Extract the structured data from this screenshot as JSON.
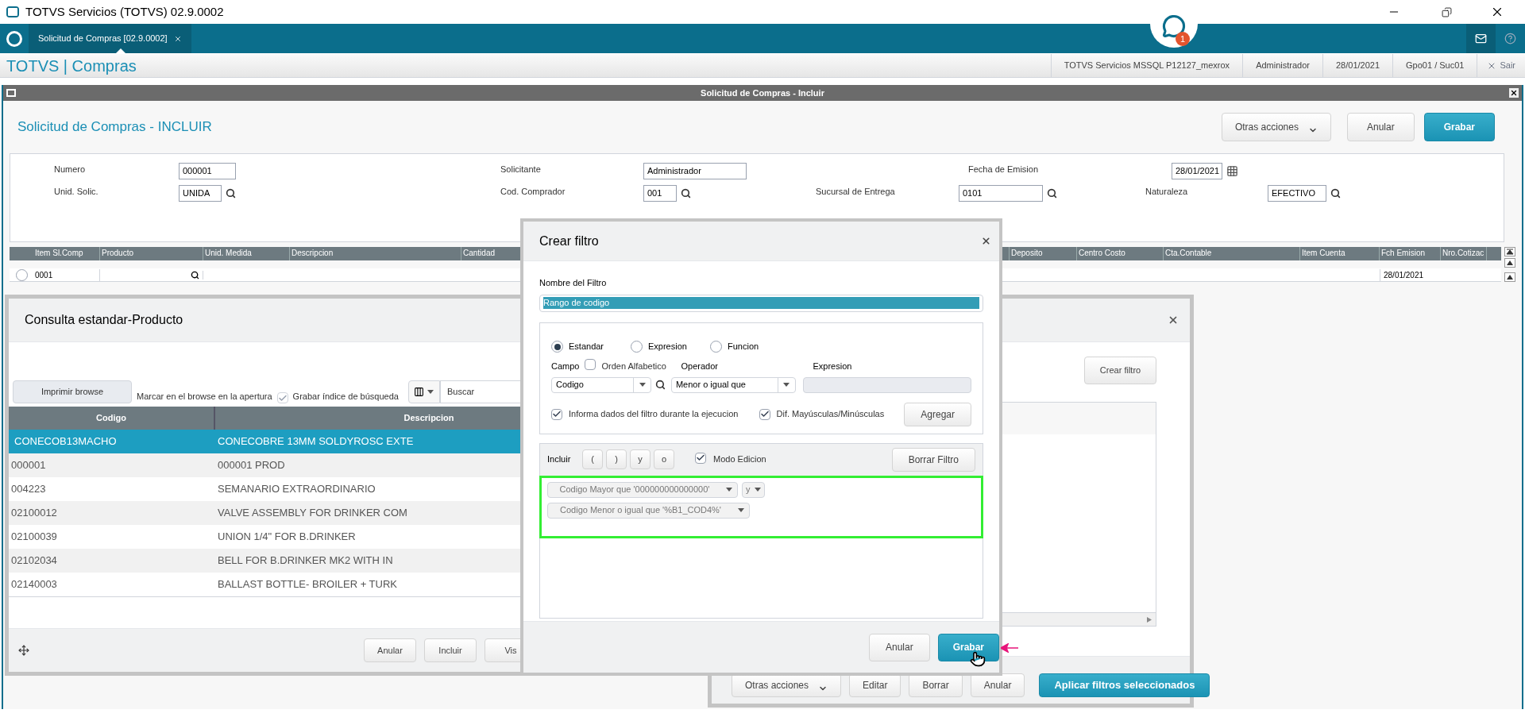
{
  "app_window": {
    "title": "TOTVS Servicios (TOTVS) 02.9.0002"
  },
  "tab_bar": {
    "tabs": [
      {
        "label": "Solicitud de Compras [02.9.0002]",
        "selected": true
      }
    ],
    "notification_count": "1"
  },
  "module_bar": {
    "title": "TOTVS | Compras",
    "info": [
      "TOTVS Servicios MSSQL P12127_mexrox",
      "Administrador",
      "28/01/2021",
      "Gpo01 / Suc01"
    ],
    "exit_label": "Sair"
  },
  "form_window": {
    "title": "Solicitud de Compras - Incluir",
    "heading": "Solicitud de Compras - INCLUIR",
    "buttons": [
      {
        "label": "Otras acciones",
        "kind": "dropdown"
      },
      {
        "label": "Anular",
        "kind": "secondary"
      },
      {
        "label": "Grabar",
        "kind": "primary"
      }
    ],
    "field_rows": [
      [
        {
          "label": "Numero",
          "value": "000001",
          "kind": "plain"
        },
        {
          "label": "Solicitante",
          "value": "Administrador",
          "kind": "plain"
        },
        {
          "label": "Fecha de Emision",
          "value": "28/01/2021",
          "kind": "calendar"
        }
      ],
      [
        {
          "label": "Unid. Solic.",
          "value": "UNIDA",
          "kind": "search"
        },
        {
          "label": "Cod. Comprador",
          "value": "001",
          "kind": "search"
        },
        {
          "label": "Sucursal de Entrega",
          "value": "0101",
          "kind": "search"
        },
        {
          "label": "Naturaleza",
          "value": "EFECTIVO",
          "kind": "search"
        }
      ]
    ],
    "grid": {
      "columns": [
        "Item Sl.Comp",
        "Producto",
        "Unid. Medida",
        "Descripcion",
        "Cantidad",
        "Deposito",
        "Centro Costo",
        "Cta.Contable",
        "Item Cuenta",
        "Fch Emision",
        "Nro.Cotizac"
      ],
      "rows": [
        {
          "selected": false,
          "item": "0001",
          "fch_emision": "28/01/2021"
        }
      ]
    }
  },
  "consulta_dialog": {
    "title": "Consulta estandar-Producto",
    "print_button": "Imprimir browse",
    "mark_label": "Marcar en el browse en la apertura",
    "save_index": {
      "label": "Grabar índice de búsqueda",
      "checked": true
    },
    "search_placeholder": "Buscar",
    "columns": [
      "Codigo",
      "Descripcion"
    ],
    "rows": [
      {
        "codigo": "CONECOB13MACHO",
        "descripcion": "CONECOBRE 13MM SOLDYROSC EXTE",
        "selected": true
      },
      {
        "codigo": "000001",
        "descripcion": "000001 PROD",
        "selected": false
      },
      {
        "codigo": "004223",
        "descripcion": "SEMANARIO EXTRAORDINARIO",
        "selected": false
      },
      {
        "codigo": "02100012",
        "descripcion": "VALVE ASSEMBLY FOR DRINKER COM",
        "selected": false
      },
      {
        "codigo": "02100039",
        "descripcion": "UNION 1/4\" FOR B.DRINKER",
        "selected": false
      },
      {
        "codigo": "02102034",
        "descripcion": "BELL FOR B.DRINKER MK2 WITH IN",
        "selected": false
      },
      {
        "codigo": "02140003",
        "descripcion": "BALLAST BOTTLE- BROILER + TURK",
        "selected": false
      }
    ],
    "buttons": [
      "Anular",
      "Incluir",
      "Vis"
    ]
  },
  "filters_dialog": {
    "create_button": "Crear filtro",
    "buttons": [
      {
        "label": "Otras acciones",
        "kind": "dropdown"
      },
      {
        "label": "Editar",
        "kind": "secondary"
      },
      {
        "label": "Borrar",
        "kind": "secondary"
      },
      {
        "label": "Anular",
        "kind": "secondary"
      },
      {
        "label": "Aplicar filtros seleccionados",
        "kind": "primary"
      }
    ]
  },
  "crear_filtro": {
    "title": "Crear filtro",
    "name_label": "Nombre del Filtro",
    "name_value": "Rango de codigo",
    "types": [
      {
        "label": "Estandar",
        "selected": true
      },
      {
        "label": "Expresion",
        "selected": false
      },
      {
        "label": "Funcion",
        "selected": false
      }
    ],
    "campo_label": "Campo",
    "alpha_order": {
      "label": "Orden Alfabetico",
      "checked": false
    },
    "campo_value": "Codigo",
    "operator_label": "Operador",
    "operator_value": "Menor o igual que",
    "expression_label": "Expresion",
    "options": [
      {
        "label": "Informa dados del filtro durante la ejecucion",
        "checked": true
      },
      {
        "label": "Dif. Mayúsculas/Minúsculas",
        "checked": true
      }
    ],
    "add_button": "Agregar",
    "include_label": "Incluir",
    "include_buttons": [
      "(",
      ")",
      "y",
      "o"
    ],
    "edit_mode": {
      "label": "Modo Edicion",
      "checked": true
    },
    "clear_button": "Borrar Filtro",
    "conditions": [
      {
        "text": "Codigo Mayor que '000000000000000'",
        "connector": "y"
      },
      {
        "text": "Codigo Menor o igual que '%B1_COD4%'"
      }
    ],
    "buttons": [
      {
        "label": "Anular",
        "kind": "secondary"
      },
      {
        "label": "Grabar",
        "kind": "primary"
      }
    ]
  }
}
